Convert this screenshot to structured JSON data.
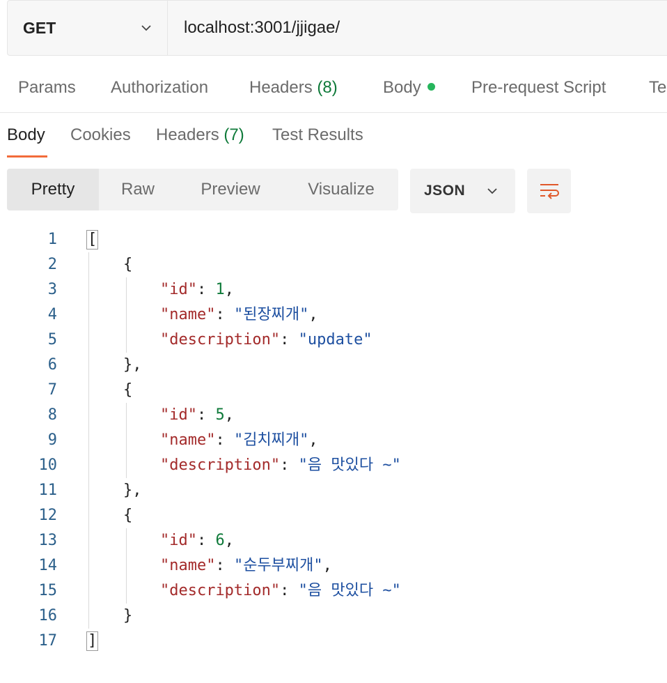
{
  "request": {
    "method": "GET",
    "url": "localhost:3001/jjigae/"
  },
  "request_tabs": [
    {
      "label": "Params"
    },
    {
      "label": "Authorization"
    },
    {
      "label": "Headers",
      "count": "(8)"
    },
    {
      "label": "Body",
      "has_dot": true
    },
    {
      "label": "Pre-request Script"
    },
    {
      "label": "Te"
    }
  ],
  "response_tabs": [
    {
      "label": "Body",
      "active": true
    },
    {
      "label": "Cookies"
    },
    {
      "label": "Headers",
      "count": "(7)"
    },
    {
      "label": "Test Results"
    }
  ],
  "view_modes": [
    {
      "label": "Pretty",
      "active": true
    },
    {
      "label": "Raw"
    },
    {
      "label": "Preview"
    },
    {
      "label": "Visualize"
    }
  ],
  "format": "JSON",
  "icons": {
    "method_dropdown": "chevron-down-icon",
    "format_dropdown": "chevron-down-icon",
    "wrap": "wrap-lines-icon"
  },
  "colors": {
    "accent": "#f26b3a",
    "status_dot": "#26b55c",
    "json_key": "#a32a2a",
    "json_number": "#0f7a3a",
    "json_string": "#1d4fa0",
    "line_number": "#2b5f8a"
  },
  "response_lines": [
    {
      "n": "1",
      "parts": [
        {
          "t": "p",
          "v": "["
        }
      ]
    },
    {
      "n": "2",
      "parts": [
        {
          "t": "p",
          "v": "    {"
        }
      ]
    },
    {
      "n": "3",
      "parts": [
        {
          "t": "p",
          "v": "        "
        },
        {
          "t": "k",
          "v": "\"id\""
        },
        {
          "t": "p",
          "v": ": "
        },
        {
          "t": "n",
          "v": "1"
        },
        {
          "t": "p",
          "v": ","
        }
      ]
    },
    {
      "n": "4",
      "parts": [
        {
          "t": "p",
          "v": "        "
        },
        {
          "t": "k",
          "v": "\"name\""
        },
        {
          "t": "p",
          "v": ": "
        },
        {
          "t": "s",
          "v": "\"된장찌개\""
        },
        {
          "t": "p",
          "v": ","
        }
      ]
    },
    {
      "n": "5",
      "parts": [
        {
          "t": "p",
          "v": "        "
        },
        {
          "t": "k",
          "v": "\"description\""
        },
        {
          "t": "p",
          "v": ": "
        },
        {
          "t": "s",
          "v": "\"update\""
        }
      ]
    },
    {
      "n": "6",
      "parts": [
        {
          "t": "p",
          "v": "    },"
        }
      ]
    },
    {
      "n": "7",
      "parts": [
        {
          "t": "p",
          "v": "    {"
        }
      ]
    },
    {
      "n": "8",
      "parts": [
        {
          "t": "p",
          "v": "        "
        },
        {
          "t": "k",
          "v": "\"id\""
        },
        {
          "t": "p",
          "v": ": "
        },
        {
          "t": "n",
          "v": "5"
        },
        {
          "t": "p",
          "v": ","
        }
      ]
    },
    {
      "n": "9",
      "parts": [
        {
          "t": "p",
          "v": "        "
        },
        {
          "t": "k",
          "v": "\"name\""
        },
        {
          "t": "p",
          "v": ": "
        },
        {
          "t": "s",
          "v": "\"김치찌개\""
        },
        {
          "t": "p",
          "v": ","
        }
      ]
    },
    {
      "n": "10",
      "parts": [
        {
          "t": "p",
          "v": "        "
        },
        {
          "t": "k",
          "v": "\"description\""
        },
        {
          "t": "p",
          "v": ": "
        },
        {
          "t": "s",
          "v": "\"음 맛있다 ~\""
        }
      ]
    },
    {
      "n": "11",
      "parts": [
        {
          "t": "p",
          "v": "    },"
        }
      ]
    },
    {
      "n": "12",
      "parts": [
        {
          "t": "p",
          "v": "    {"
        }
      ]
    },
    {
      "n": "13",
      "parts": [
        {
          "t": "p",
          "v": "        "
        },
        {
          "t": "k",
          "v": "\"id\""
        },
        {
          "t": "p",
          "v": ": "
        },
        {
          "t": "n",
          "v": "6"
        },
        {
          "t": "p",
          "v": ","
        }
      ]
    },
    {
      "n": "14",
      "parts": [
        {
          "t": "p",
          "v": "        "
        },
        {
          "t": "k",
          "v": "\"name\""
        },
        {
          "t": "p",
          "v": ": "
        },
        {
          "t": "s",
          "v": "\"순두부찌개\""
        },
        {
          "t": "p",
          "v": ","
        }
      ]
    },
    {
      "n": "15",
      "parts": [
        {
          "t": "p",
          "v": "        "
        },
        {
          "t": "k",
          "v": "\"description\""
        },
        {
          "t": "p",
          "v": ": "
        },
        {
          "t": "s",
          "v": "\"음 맛있다 ~\""
        }
      ]
    },
    {
      "n": "16",
      "parts": [
        {
          "t": "p",
          "v": "    }"
        }
      ]
    },
    {
      "n": "17",
      "parts": [
        {
          "t": "p",
          "v": "]"
        }
      ]
    }
  ]
}
